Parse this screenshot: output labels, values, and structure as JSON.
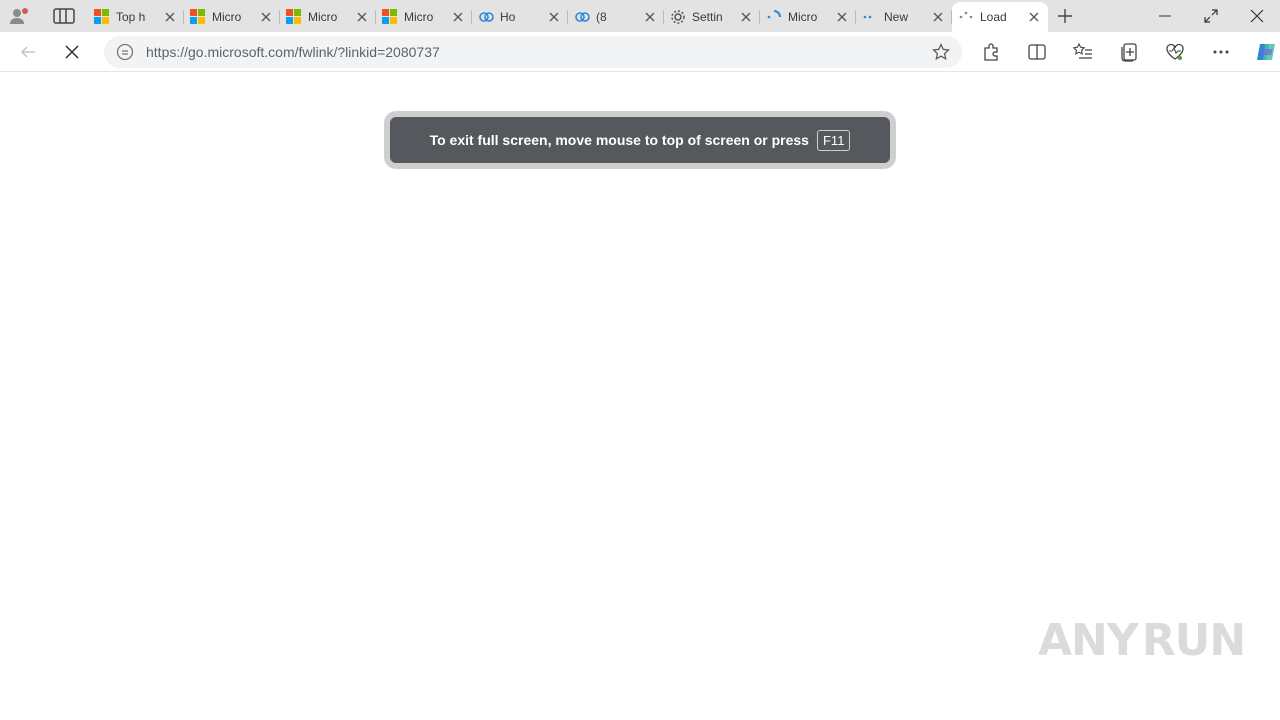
{
  "browser": {
    "tabs": [
      {
        "title": "Top h",
        "icon": "microsoft-logo-icon",
        "active": false
      },
      {
        "title": "Micro",
        "icon": "microsoft-logo-icon",
        "active": false
      },
      {
        "title": "Micro",
        "icon": "microsoft-logo-icon",
        "active": false
      },
      {
        "title": "Micro",
        "icon": "microsoft-logo-icon",
        "active": false
      },
      {
        "title": "Ho",
        "icon": "link-icon",
        "active": false
      },
      {
        "title": "(8",
        "icon": "link-icon",
        "active": false
      },
      {
        "title": "Settin",
        "icon": "gear-icon",
        "active": false
      },
      {
        "title": "Micro",
        "icon": "loading-icon",
        "active": false
      },
      {
        "title": "New",
        "icon": "loading-icon",
        "active": false
      },
      {
        "title": "Load",
        "icon": "loading-icon",
        "active": true
      }
    ],
    "address_bar": {
      "url": "https://go.microsoft.com/fwlink/?linkid=2080737"
    }
  },
  "notification": {
    "message": "To exit full screen, move mouse to top of screen or press",
    "key": "F11"
  },
  "watermark": {
    "left": "ANY",
    "right": "RUN"
  },
  "colors": {
    "tabstrip_bg": "#e3e3e3",
    "toolbar_bg": "#ffffff",
    "toast_bg": "#55585c",
    "copilot_accent": "#2b88d8"
  }
}
